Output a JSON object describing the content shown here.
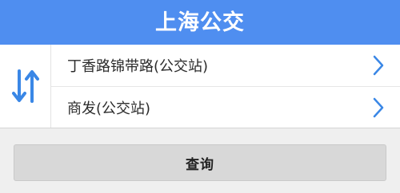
{
  "header": {
    "title": "上海公交"
  },
  "route": {
    "from_stop": "丁香路锦带路(公交站)",
    "to_stop": "商发(公交站)",
    "swap_icon": "swap-vertical-arrows-icon",
    "row_icon": "chevron-right-icon"
  },
  "actions": {
    "query_label": "查询"
  },
  "colors": {
    "header_bg": "#4f8ef0",
    "accent": "#3a87e6",
    "button_bg": "#d8d8d8"
  }
}
